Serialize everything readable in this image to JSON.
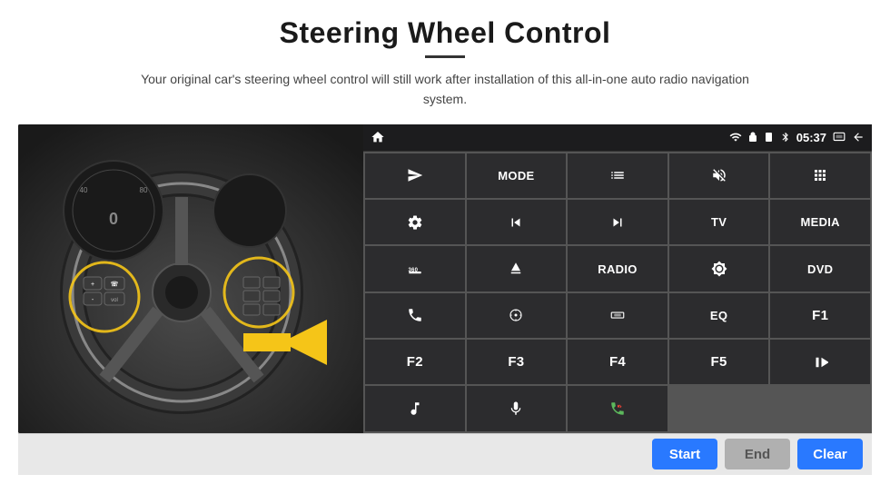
{
  "page": {
    "title": "Steering Wheel Control",
    "subtitle": "Your original car's steering wheel control will still work after installation of this all-in-one auto radio navigation system.",
    "divider": true
  },
  "status_bar": {
    "time": "05:37",
    "icons": [
      "home",
      "wifi",
      "lock",
      "sd",
      "bluetooth",
      "mirror",
      "back"
    ]
  },
  "buttons": [
    {
      "id": "r1c1",
      "type": "icon",
      "icon": "send",
      "label": ""
    },
    {
      "id": "r1c2",
      "type": "text",
      "label": "MODE"
    },
    {
      "id": "r1c3",
      "type": "icon",
      "icon": "list",
      "label": ""
    },
    {
      "id": "r1c4",
      "type": "icon",
      "icon": "mute",
      "label": ""
    },
    {
      "id": "r1c5",
      "type": "icon",
      "icon": "apps",
      "label": ""
    },
    {
      "id": "r2c1",
      "type": "icon",
      "icon": "settings",
      "label": ""
    },
    {
      "id": "r2c2",
      "type": "icon",
      "icon": "prev",
      "label": ""
    },
    {
      "id": "r2c3",
      "type": "icon",
      "icon": "next",
      "label": ""
    },
    {
      "id": "r2c4",
      "type": "text",
      "label": "TV"
    },
    {
      "id": "r2c5",
      "type": "text",
      "label": "MEDIA"
    },
    {
      "id": "r3c1",
      "type": "text",
      "label": "360"
    },
    {
      "id": "r3c2",
      "type": "icon",
      "icon": "eject",
      "label": ""
    },
    {
      "id": "r3c3",
      "type": "text",
      "label": "RADIO"
    },
    {
      "id": "r3c4",
      "type": "icon",
      "icon": "brightness",
      "label": ""
    },
    {
      "id": "r3c5",
      "type": "text",
      "label": "DVD"
    },
    {
      "id": "r4c1",
      "type": "icon",
      "icon": "phone",
      "label": ""
    },
    {
      "id": "r4c2",
      "type": "icon",
      "icon": "navi",
      "label": ""
    },
    {
      "id": "r4c3",
      "type": "icon",
      "icon": "panel",
      "label": ""
    },
    {
      "id": "r4c4",
      "type": "text",
      "label": "EQ"
    },
    {
      "id": "r4c5",
      "type": "text",
      "label": "F1"
    },
    {
      "id": "r5c1",
      "type": "text",
      "label": "F2"
    },
    {
      "id": "r5c2",
      "type": "text",
      "label": "F3"
    },
    {
      "id": "r5c3",
      "type": "text",
      "label": "F4"
    },
    {
      "id": "r5c4",
      "type": "text",
      "label": "F5"
    },
    {
      "id": "r5c5",
      "type": "icon",
      "icon": "playpause",
      "label": ""
    },
    {
      "id": "r6c1",
      "type": "icon",
      "icon": "music",
      "label": ""
    },
    {
      "id": "r6c2",
      "type": "icon",
      "icon": "mic",
      "label": ""
    },
    {
      "id": "r6c3",
      "type": "icon",
      "icon": "answer",
      "label": ""
    }
  ],
  "action_bar": {
    "start_label": "Start",
    "end_label": "End",
    "clear_label": "Clear"
  }
}
